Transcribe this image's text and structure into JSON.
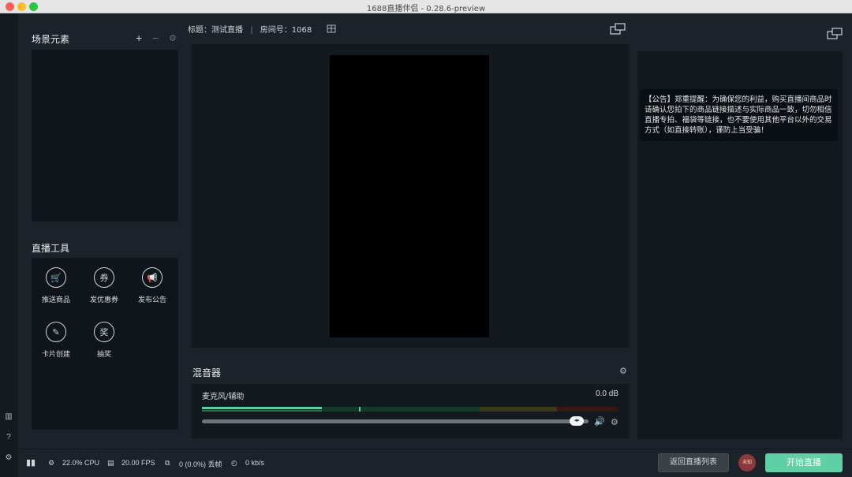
{
  "window": {
    "title": "1688直播伴侣 - 0.28.6-preview"
  },
  "scene": {
    "title": "场景元素",
    "add": "+",
    "remove": "−",
    "settings": "⚙"
  },
  "tools": {
    "title": "直播工具",
    "items": [
      {
        "label": "推送商品",
        "icon": "cart-icon",
        "glyph": "🛒"
      },
      {
        "label": "发优惠券",
        "icon": "coupon-icon",
        "glyph": "券"
      },
      {
        "label": "发布公告",
        "icon": "megaphone-icon",
        "glyph": "📢"
      },
      {
        "label": "卡片创建",
        "icon": "card-icon",
        "glyph": "✎"
      },
      {
        "label": "抽奖",
        "icon": "prize-icon",
        "glyph": "奖"
      }
    ]
  },
  "header": {
    "title_label": "标题：",
    "title_value": "测试直播",
    "room_label": "房间号：",
    "room_value": "1068"
  },
  "notice": {
    "text": "【公告】郑重提醒：为确保您的利益，购买直播间商品时请确认您拍下的商品链接描述与实际商品一致，切勿相信直播专拍、福袋等链接，也不要使用其他平台以外的交易方式（如直接转账），谨防上当受骗！"
  },
  "mixer": {
    "title": "混音器",
    "channel_name": "麦克风/辅助",
    "level": "0.0 dB",
    "volume_fraction": 0.97
  },
  "status": {
    "cpu": "22.0% CPU",
    "fps": "20.00 FPS",
    "dropped": "0 (0.0%) 丢帧",
    "bitrate": "0 kb/s"
  },
  "buttons": {
    "back": "返回直播列表",
    "start": "开始直播",
    "avatar": "未知"
  },
  "colors": {
    "accent": "#5fd0a6",
    "panel": "#121a20",
    "background": "#1b2229"
  }
}
